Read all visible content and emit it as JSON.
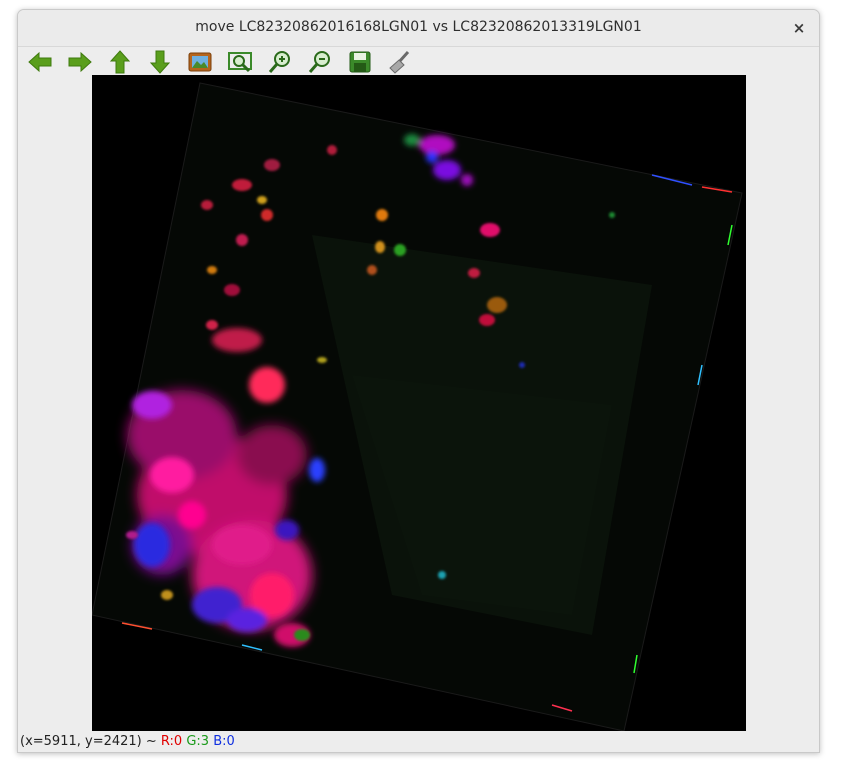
{
  "window": {
    "title": "move LC82320862016168LGN01 vs LC82320862013319LGN01",
    "close_glyph": "×"
  },
  "toolbar": {
    "buttons": [
      {
        "name": "back-arrow-icon",
        "color": "#5a9e1c"
      },
      {
        "name": "forward-arrow-icon",
        "color": "#5a9e1c"
      },
      {
        "name": "up-arrow-icon",
        "color": "#5a9e1c"
      },
      {
        "name": "down-arrow-icon",
        "color": "#5a9e1c"
      },
      {
        "name": "image-frame-icon",
        "color": "#b5651d"
      },
      {
        "name": "zoom-fit-icon",
        "color": "#3b8a2a"
      },
      {
        "name": "zoom-in-icon",
        "color": "#3b8a2a"
      },
      {
        "name": "zoom-out-icon",
        "color": "#3b8a2a"
      },
      {
        "name": "save-icon",
        "color": "#3b8a2a"
      },
      {
        "name": "clear-brush-icon",
        "color": "#8a8a8a"
      }
    ]
  },
  "status": {
    "coords": "(x=5911, y=2421) ~ ",
    "r": "R:0",
    "g": "G:3",
    "b": "B:0"
  },
  "colors": {
    "viewport_bg": "#000000",
    "status_r": "#e00000",
    "status_g": "#1a9a1a",
    "status_b": "#1030e0"
  }
}
